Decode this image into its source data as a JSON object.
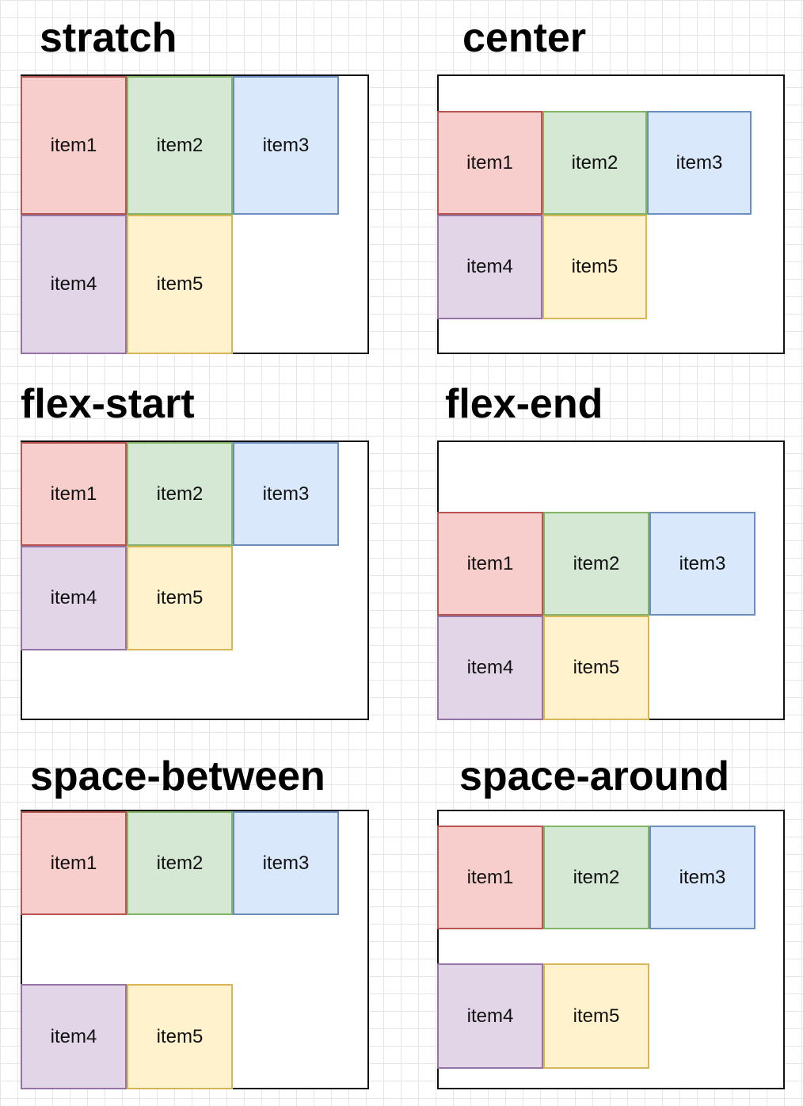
{
  "panels": [
    {
      "title": "stratch",
      "items": [
        "item1",
        "item2",
        "item3",
        "item4",
        "item5"
      ]
    },
    {
      "title": "center",
      "items": [
        "item1",
        "item2",
        "item3",
        "item4",
        "item5"
      ]
    },
    {
      "title": "flex-start",
      "items": [
        "item1",
        "item2",
        "item3",
        "item4",
        "item5"
      ]
    },
    {
      "title": "flex-end",
      "items": [
        "item1",
        "item2",
        "item3",
        "item4",
        "item5"
      ]
    },
    {
      "title": "space-between",
      "items": [
        "item1",
        "item2",
        "item3",
        "item4",
        "item5"
      ]
    },
    {
      "title": "space-around",
      "items": [
        "item1",
        "item2",
        "item3",
        "item4",
        "item5"
      ]
    }
  ],
  "colors": {
    "item1": {
      "fill": "#f8cecc",
      "stroke": "#b85450"
    },
    "item2": {
      "fill": "#d5e8d4",
      "stroke": "#82b366"
    },
    "item3": {
      "fill": "#dae8fc",
      "stroke": "#6c8ebf"
    },
    "item4": {
      "fill": "#e1d5e7",
      "stroke": "#9673a6"
    },
    "item5": {
      "fill": "#fff2cc",
      "stroke": "#d6b656"
    }
  }
}
